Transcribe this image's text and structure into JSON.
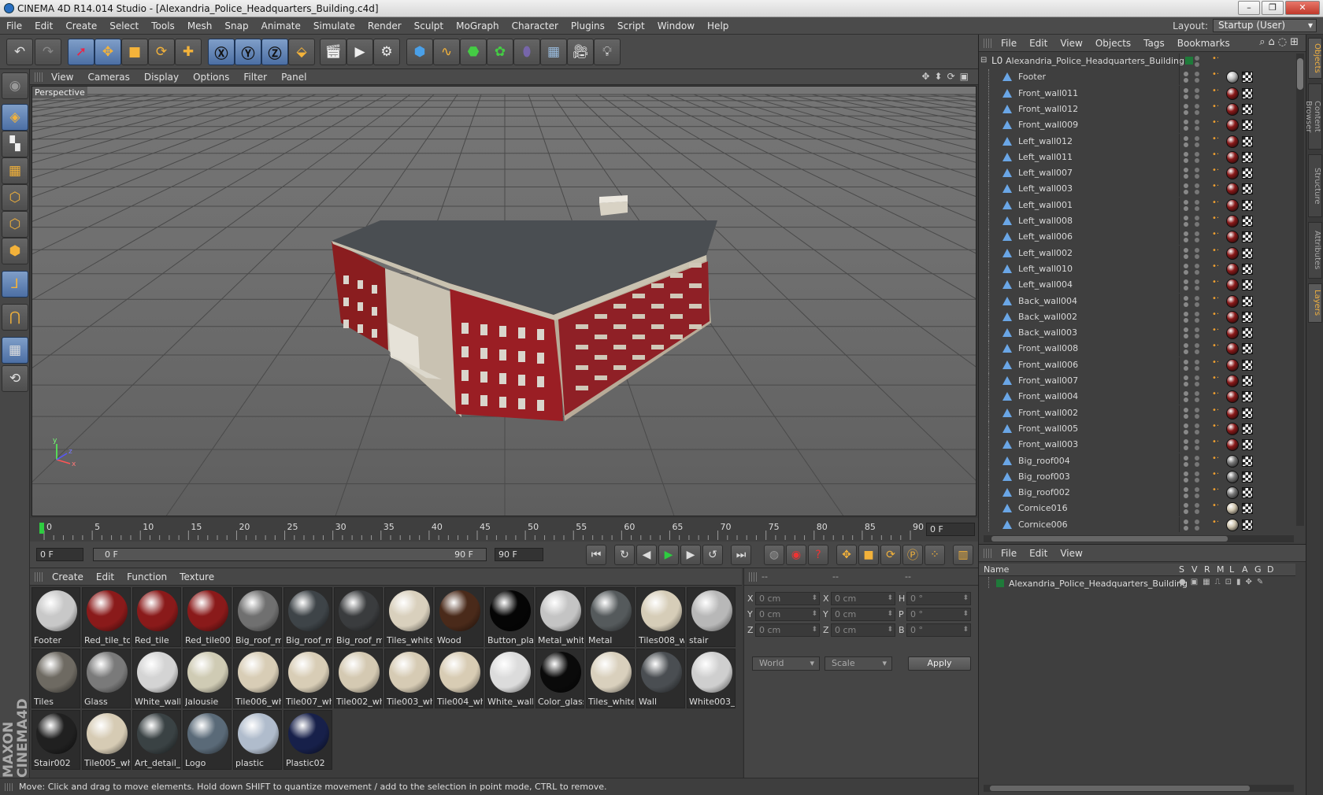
{
  "window": {
    "title": "CINEMA 4D R14.014 Studio - [Alexandria_Police_Headquarters_Building.c4d]",
    "minimize": "–",
    "maximize": "❐",
    "close": "✕"
  },
  "menubar": {
    "items": [
      "File",
      "Edit",
      "Create",
      "Select",
      "Tools",
      "Mesh",
      "Snap",
      "Animate",
      "Simulate",
      "Render",
      "Sculpt",
      "MoGraph",
      "Character",
      "Plugins",
      "Script",
      "Window",
      "Help"
    ],
    "layout_label": "Layout:",
    "layout_value": "Startup (User)"
  },
  "viewport": {
    "menu": [
      "View",
      "Cameras",
      "Display",
      "Options",
      "Filter",
      "Panel"
    ],
    "label": "Perspective",
    "axis": {
      "x": "x",
      "y": "y",
      "z": "z"
    }
  },
  "timeline": {
    "ticks": [
      "0",
      "5",
      "10",
      "15",
      "20",
      "25",
      "30",
      "35",
      "40",
      "45",
      "50",
      "55",
      "60",
      "65",
      "70",
      "75",
      "80",
      "85",
      "90"
    ],
    "current_frame": "0 F",
    "start": "0 F",
    "range_start": "0 F",
    "range_end": "90 F",
    "end": "90 F"
  },
  "materials": {
    "menu": [
      "Create",
      "Edit",
      "Function",
      "Texture"
    ],
    "items": [
      {
        "name": "Footer",
        "color": "#c8c8c8"
      },
      {
        "name": "Red_tile_to",
        "color": "#8a1a1a"
      },
      {
        "name": "Red_tile",
        "color": "#8a1a1a"
      },
      {
        "name": "Red_tile002",
        "color": "#8a1a1a"
      },
      {
        "name": "Big_roof_m",
        "color": "#707070"
      },
      {
        "name": "Big_roof_m",
        "color": "#3e4448"
      },
      {
        "name": "Big_roof_m",
        "color": "#3a3c3e"
      },
      {
        "name": "Tiles_white",
        "color": "#d9d0bd"
      },
      {
        "name": "Wood",
        "color": "#4a2a1a"
      },
      {
        "name": "Button_pla",
        "color": "#050505"
      },
      {
        "name": "Metal_whit",
        "color": "#c4c4c4"
      },
      {
        "name": "Metal",
        "color": "#555a5c"
      },
      {
        "name": "Tiles008_wl",
        "color": "#d6cdb8"
      },
      {
        "name": "stair",
        "color": "#b8b8b8"
      },
      {
        "name": "Tiles",
        "color": "#6e6a62"
      },
      {
        "name": "Glass",
        "color": "#7a7a7a"
      },
      {
        "name": "White_wall",
        "color": "#d4d4d4"
      },
      {
        "name": "Jalousie",
        "color": "#cfcbb4"
      },
      {
        "name": "Tile006_wh",
        "color": "#d8cdb6"
      },
      {
        "name": "Tile007_wh",
        "color": "#d8cdb6"
      },
      {
        "name": "Tile002_wh",
        "color": "#d4c9b2"
      },
      {
        "name": "Tile003_wh",
        "color": "#d6cbb4"
      },
      {
        "name": "Tile004_wh",
        "color": "#d8ccb4"
      },
      {
        "name": "White_wall",
        "color": "#dcdcdc"
      },
      {
        "name": "Color_glass",
        "color": "#0a0a0a"
      },
      {
        "name": "Tiles_white",
        "color": "#d9d0bd"
      },
      {
        "name": "Wall",
        "color": "#4a4e52"
      },
      {
        "name": "White003_",
        "color": "#cfcfcf"
      },
      {
        "name": "Stair002",
        "color": "#202020"
      },
      {
        "name": "Tile005_wh",
        "color": "#d6cbb4"
      },
      {
        "name": "Art_detail_",
        "color": "#3a4244"
      },
      {
        "name": "Logo",
        "color": "#5a6a78"
      },
      {
        "name": "plastic",
        "color": "#b0bccc"
      },
      {
        "name": "Plastic02",
        "color": "#17204a"
      }
    ]
  },
  "attributes": {
    "header_a": "--",
    "header_b": "--",
    "rows": [
      {
        "l1": "X",
        "v1": "0 cm",
        "l2": "X",
        "v2": "0 cm",
        "l3": "H",
        "v3": "0 °"
      },
      {
        "l1": "Y",
        "v1": "0 cm",
        "l2": "Y",
        "v2": "0 cm",
        "l3": "P",
        "v3": "0 °"
      },
      {
        "l1": "Z",
        "v1": "0 cm",
        "l2": "Z",
        "v2": "0 cm",
        "l3": "B",
        "v3": "0 °"
      }
    ],
    "coord_mode": "World",
    "size_mode": "Scale",
    "apply": "Apply"
  },
  "status": {
    "text": "Move: Click and drag to move elements. Hold down SHIFT to quantize movement / add to the selection in point mode, CTRL to remove."
  },
  "objects": {
    "menu": [
      "File",
      "Edit",
      "View",
      "Objects",
      "Tags",
      "Bookmarks"
    ],
    "root": "Alexandria_Police_Headquarters_Building",
    "items": [
      {
        "name": "Footer",
        "mat": "#c0c0c0"
      },
      {
        "name": "Front_wall011",
        "mat": "#8a1a1a"
      },
      {
        "name": "Front_wall012",
        "mat": "#8a1a1a"
      },
      {
        "name": "Front_wall009",
        "mat": "#8a1a1a"
      },
      {
        "name": "Left_wall012",
        "mat": "#8a1a1a"
      },
      {
        "name": "Left_wall011",
        "mat": "#8a1a1a"
      },
      {
        "name": "Left_wall007",
        "mat": "#8a1a1a"
      },
      {
        "name": "Left_wall003",
        "mat": "#8a1a1a"
      },
      {
        "name": "Left_wall001",
        "mat": "#8a1a1a"
      },
      {
        "name": "Left_wall008",
        "mat": "#8a1a1a"
      },
      {
        "name": "Left_wall006",
        "mat": "#8a1a1a"
      },
      {
        "name": "Left_wall002",
        "mat": "#8a1a1a"
      },
      {
        "name": "Left_wall010",
        "mat": "#8a1a1a"
      },
      {
        "name": "Left_wall004",
        "mat": "#8a1a1a"
      },
      {
        "name": "Back_wall004",
        "mat": "#8a1a1a"
      },
      {
        "name": "Back_wall002",
        "mat": "#8a1a1a"
      },
      {
        "name": "Back_wall003",
        "mat": "#8a1a1a"
      },
      {
        "name": "Front_wall008",
        "mat": "#8a1a1a"
      },
      {
        "name": "Front_wall006",
        "mat": "#8a1a1a"
      },
      {
        "name": "Front_wall007",
        "mat": "#8a1a1a"
      },
      {
        "name": "Front_wall004",
        "mat": "#8a1a1a"
      },
      {
        "name": "Front_wall002",
        "mat": "#8a1a1a"
      },
      {
        "name": "Front_wall005",
        "mat": "#8a1a1a"
      },
      {
        "name": "Front_wall003",
        "mat": "#8a1a1a"
      },
      {
        "name": "Big_roof004",
        "mat": "#777777"
      },
      {
        "name": "Big_roof003",
        "mat": "#777777"
      },
      {
        "name": "Big_roof002",
        "mat": "#777777"
      },
      {
        "name": "Cornice016",
        "mat": "#d0c6b0"
      },
      {
        "name": "Cornice006",
        "mat": "#d0c6b0"
      }
    ]
  },
  "layers": {
    "menu": [
      "File",
      "Edit",
      "View"
    ],
    "columns": [
      "Name",
      "S",
      "V",
      "R",
      "M",
      "L",
      "A",
      "G",
      "D"
    ],
    "row": "Alexandria_Police_Headquarters_Building"
  },
  "right_tabs": [
    "Objects",
    "Content Browser",
    "Structure",
    "Attributes",
    "Layers"
  ]
}
